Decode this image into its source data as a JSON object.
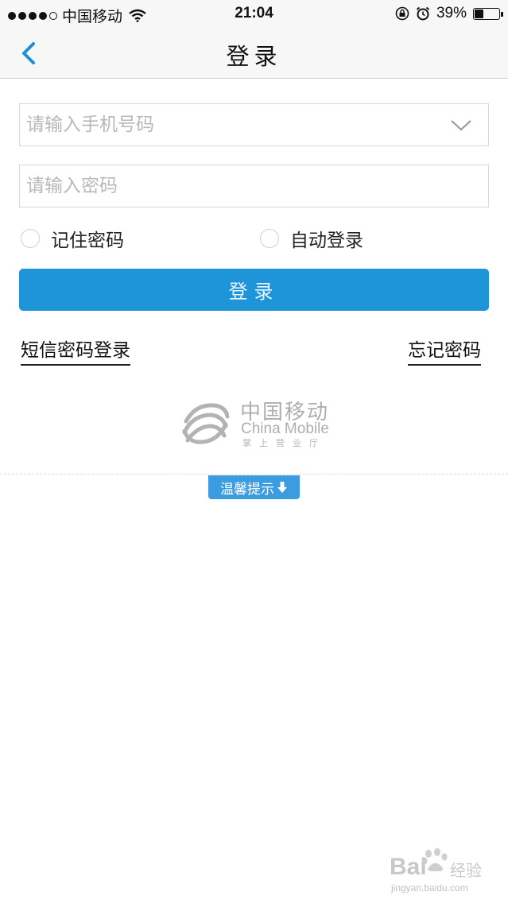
{
  "status_bar": {
    "carrier": "中国移动",
    "time": "21:04",
    "battery_percent": "39%",
    "battery_level": 0.39,
    "icons": [
      "signal-dots-icon",
      "wifi-icon",
      "rotation-lock-icon",
      "alarm-icon",
      "battery-icon"
    ]
  },
  "nav": {
    "title": "登录",
    "back_icon": "chevron-left-icon"
  },
  "form": {
    "phone_placeholder": "请输入手机号码",
    "phone_value": "",
    "password_placeholder": "请输入密码",
    "password_value": "",
    "dropdown_icon": "chevron-down-icon",
    "remember_password_label": "记住密码",
    "auto_login_label": "自动登录",
    "login_button_label": "登录"
  },
  "links": {
    "sms_login": "短信密码登录",
    "forgot_password": "忘记密码"
  },
  "logo": {
    "name": "中国移动",
    "english": "China Mobile",
    "subtitle": "掌上营业厅"
  },
  "tip": {
    "label": "温馨提示",
    "icon": "arrow-down-icon"
  },
  "watermark": {
    "brand": "Bai",
    "brand_cn": "经验",
    "url": "jingyan.baidu.com"
  },
  "colors": {
    "accent": "#1e95d8",
    "tip": "#3b9de0",
    "back_icon": "#1e8fd5"
  }
}
